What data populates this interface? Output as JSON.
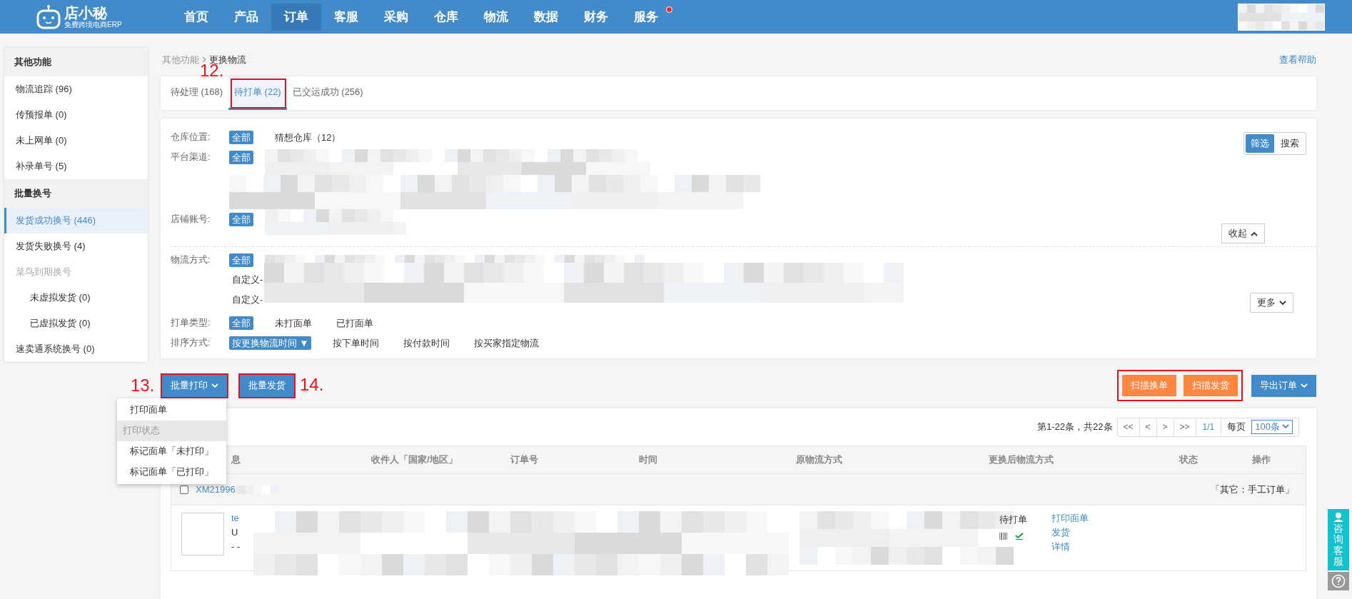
{
  "header": {
    "logo": {
      "name": "店小秘",
      "tagline": "免费跨境电商ERP"
    },
    "nav": [
      {
        "label": "首页",
        "selected": false,
        "badge": false
      },
      {
        "label": "产品",
        "selected": false,
        "badge": false
      },
      {
        "label": "订单",
        "selected": true,
        "badge": false
      },
      {
        "label": "客服",
        "selected": false,
        "badge": false
      },
      {
        "label": "采购",
        "selected": false,
        "badge": false
      },
      {
        "label": "仓库",
        "selected": false,
        "badge": false
      },
      {
        "label": "物流",
        "selected": false,
        "badge": false
      },
      {
        "label": "数据",
        "selected": false,
        "badge": false
      },
      {
        "label": "财务",
        "selected": false,
        "badge": false
      },
      {
        "label": "服务",
        "selected": false,
        "badge": true
      }
    ]
  },
  "sidebar": {
    "sections": [
      {
        "title": "其他功能",
        "items": [
          {
            "label": "物流追踪 (96)",
            "selected": false,
            "disabled": false
          },
          {
            "label": "传预报单 (0)",
            "selected": false,
            "disabled": false
          },
          {
            "label": "未上网单 (0)",
            "selected": false,
            "disabled": false
          },
          {
            "label": "补录单号 (5)",
            "selected": false,
            "disabled": false
          }
        ]
      },
      {
        "title": "批量换号",
        "items": [
          {
            "label": "发货成功换号 (446)",
            "selected": true,
            "disabled": false
          },
          {
            "label": "发货失败换号 (4)",
            "selected": false,
            "disabled": false
          },
          {
            "label": "菜鸟到期换号",
            "selected": false,
            "disabled": true,
            "children": [
              {
                "label": "未虚拟发货 (0)",
                "selected": false,
                "disabled": false
              },
              {
                "label": "已虚拟发货 (0)",
                "selected": false,
                "disabled": false
              }
            ]
          },
          {
            "label": "速卖通系统换号 (0)",
            "selected": false,
            "disabled": false
          }
        ]
      }
    ]
  },
  "breadcrumb": [
    "其他功能",
    "更换物流"
  ],
  "help_link": "查看帮助",
  "tabs": [
    {
      "label": "待处理 (168)",
      "selected": false,
      "highlighted": false
    },
    {
      "label": "待打单 (22)",
      "selected": true,
      "highlighted": true,
      "annotation": "12."
    },
    {
      "label": "已交运成功 (256)",
      "selected": false,
      "highlighted": false
    }
  ],
  "filters": [
    {
      "kind": "plain",
      "label": "仓库位置:",
      "options": [
        {
          "label": "全部",
          "selected": true
        },
        {
          "label": "猜想仓库（12）",
          "selected": false
        }
      ]
    },
    {
      "kind": "channels",
      "label": "平台渠道:",
      "options": [
        {
          "label": "全部",
          "selected": true
        }
      ]
    },
    {
      "kind": "shops",
      "label": "店铺账号:",
      "options": [
        {
          "label": "全部",
          "selected": true
        }
      ]
    },
    {
      "kind": "shipping",
      "label": "物流方式:",
      "options": [
        {
          "label": "全部",
          "selected": true
        }
      ],
      "lines": [
        "自定义-",
        "自定义-"
      ]
    },
    {
      "kind": "plain",
      "label": "打单类型:",
      "options": [
        {
          "label": "全部",
          "selected": true
        },
        {
          "label": "未打面单",
          "selected": false
        },
        {
          "label": "已打面单",
          "selected": false
        }
      ]
    },
    {
      "kind": "plain",
      "label": "排序方式:",
      "options": [
        {
          "label": "按更换物流时间 ▼",
          "selected": true
        },
        {
          "label": "按下单时间",
          "selected": false
        },
        {
          "label": "按付款时间",
          "selected": false
        },
        {
          "label": "按买家指定物流",
          "selected": false
        }
      ]
    }
  ],
  "mode_switch": [
    {
      "label": "筛选",
      "selected": true
    },
    {
      "label": "搜索",
      "selected": false
    }
  ],
  "collapse_button": "收起",
  "more_button": "更多",
  "actions": {
    "left": [
      {
        "label": "批量打印",
        "dropdown": true,
        "highlighted": true,
        "annotation": "13."
      },
      {
        "label": "批量发货",
        "dropdown": false,
        "highlighted": true,
        "annotation": "14."
      }
    ],
    "scan": [
      {
        "label": "扫描换单"
      },
      {
        "label": "扫描发货"
      }
    ],
    "scan_highlighted": true,
    "export": {
      "label": "导出订单",
      "dropdown": true
    }
  },
  "print_menu": [
    {
      "label": "打印面单",
      "kind": "item"
    },
    {
      "label": "打印状态",
      "kind": "header"
    },
    {
      "label": "标记面单「未打印」",
      "kind": "item"
    },
    {
      "label": "标记面单「已打印」",
      "kind": "item"
    }
  ],
  "pagination": {
    "summary": "第1-22条，共22条",
    "buttons": [
      "<<",
      "<",
      ">",
      ">>"
    ],
    "page": "1/1",
    "per_page_label": "每页",
    "per_page": "100条"
  },
  "table": {
    "columns": [
      "息",
      "收件人「国家/地区」",
      "订单号",
      "时间",
      "原物流方式",
      "更换后物流方式",
      "状态",
      "操作"
    ],
    "groups": [
      {
        "order_id": "XM21996",
        "checked": false,
        "tag": "「其它：手工订单」",
        "rows": [
          {
            "lines": [
              "te",
              "U",
              "- -"
            ],
            "status": "待打单",
            "actions": [
              "打印面单",
              "发货",
              "详情"
            ]
          }
        ]
      }
    ]
  },
  "support": {
    "label": "咨询客服"
  }
}
